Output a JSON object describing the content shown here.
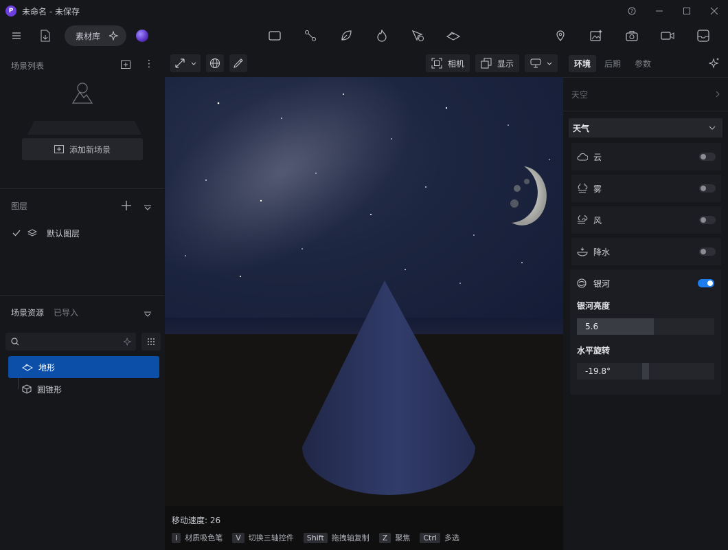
{
  "window": {
    "title": "未命名 - 未保存",
    "logo_letter": "P"
  },
  "toolbar": {
    "asset_library": "素材库"
  },
  "scene_list": {
    "title": "场景列表",
    "add_scene": "添加新场景"
  },
  "layers": {
    "title": "图层",
    "items": [
      {
        "label": "默认图层"
      }
    ]
  },
  "assets": {
    "title": "场景资源",
    "imported_tab": "已导入",
    "search_placeholder": "",
    "items": [
      {
        "label": "地形"
      },
      {
        "label": "圆锥形"
      }
    ]
  },
  "viewport": {
    "camera_label": "相机",
    "display_label": "显示",
    "move_speed": "移动速度: 26",
    "hints": [
      {
        "key": "I",
        "text": "材质吸色笔"
      },
      {
        "key": "V",
        "text": "切换三轴控件"
      },
      {
        "key": "Shift",
        "text": "拖拽轴复制"
      },
      {
        "key": "Z",
        "text": "聚焦"
      },
      {
        "key": "Ctrl",
        "text": "多选"
      }
    ]
  },
  "right_panel": {
    "tabs": [
      {
        "label": "环境"
      },
      {
        "label": "后期"
      },
      {
        "label": "参数"
      }
    ],
    "sky_section": "天空",
    "weather_section": "天气",
    "weather_items": [
      {
        "label": "云",
        "enabled": false,
        "icon": "cloud-icon"
      },
      {
        "label": "雾",
        "enabled": false,
        "icon": "fog-icon"
      },
      {
        "label": "风",
        "enabled": false,
        "icon": "wind-icon"
      },
      {
        "label": "降水",
        "enabled": false,
        "icon": "rain-icon"
      }
    ],
    "galaxy": {
      "label": "银河",
      "enabled": true,
      "brightness_label": "银河亮度",
      "brightness_value": "5.6",
      "brightness_fraction": 0.56,
      "rotation_label": "水平旋转",
      "rotation_value": "-19.8°",
      "rotation_fraction": 0.5
    }
  },
  "colors": {
    "accent": "#1c7cf0",
    "selection": "#0b4fa8"
  }
}
